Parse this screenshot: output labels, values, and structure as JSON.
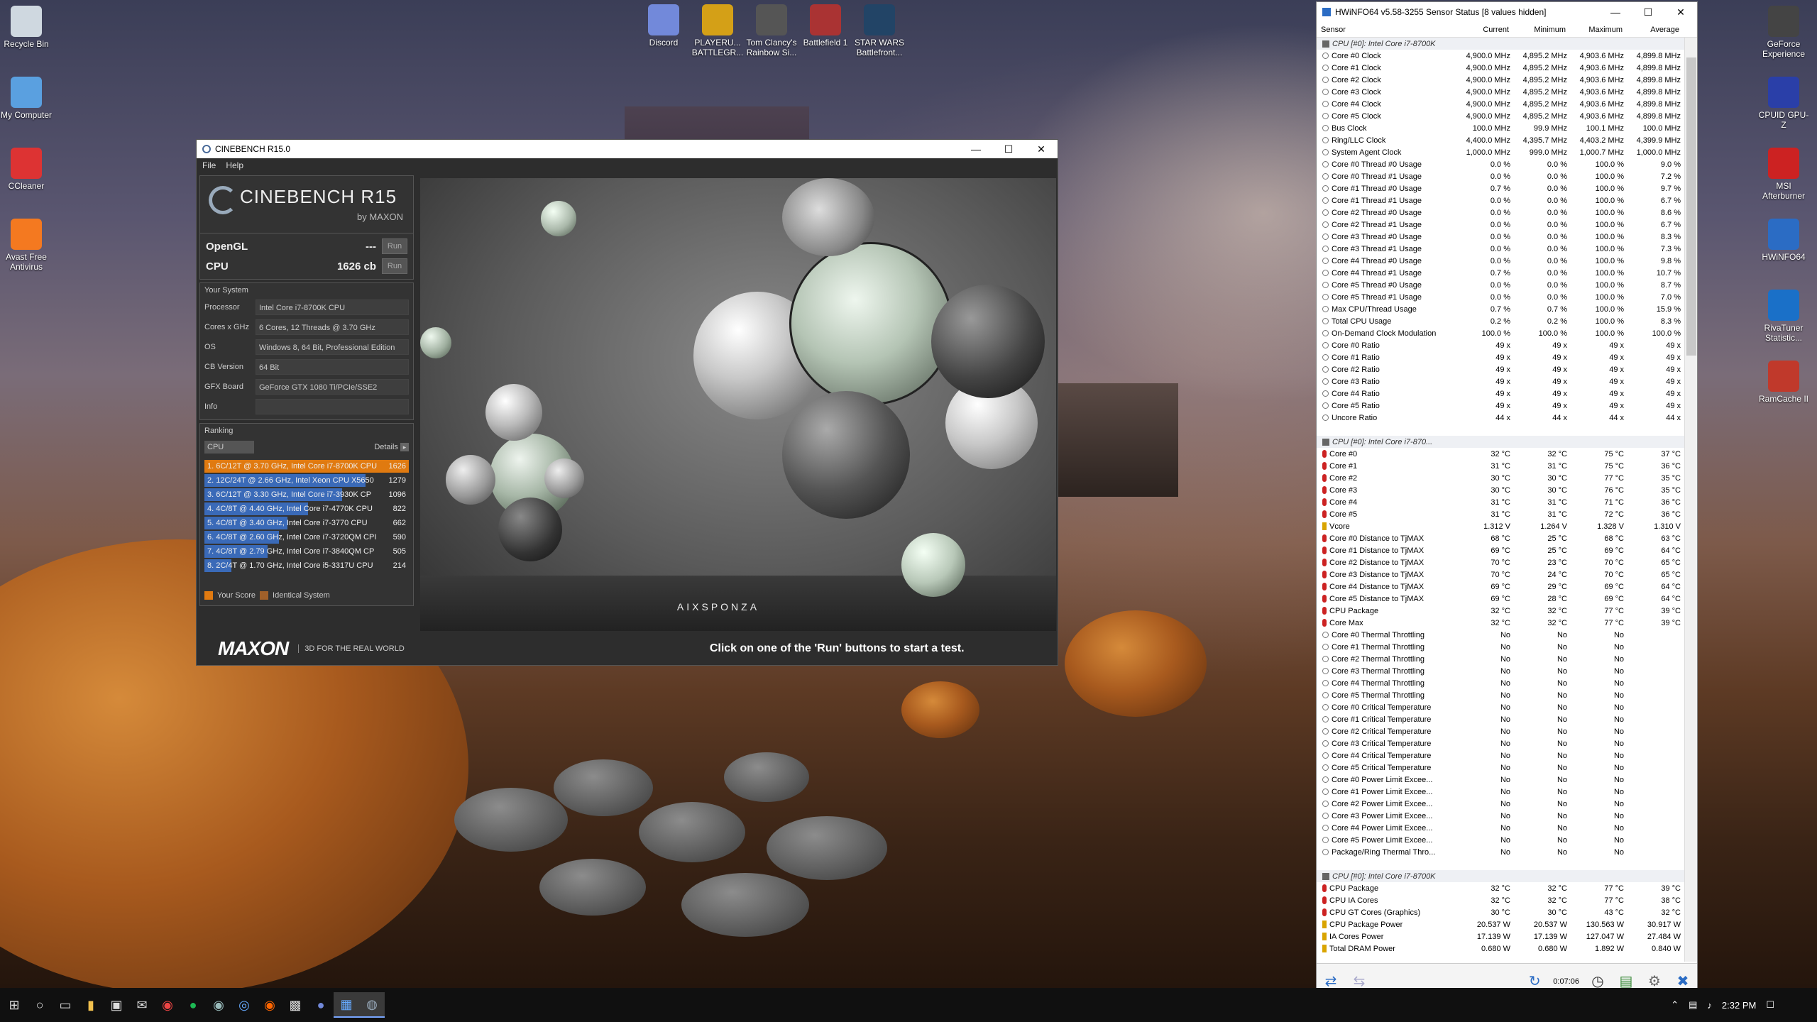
{
  "desktop": {
    "icons_left": [
      {
        "label": "Recycle Bin",
        "icon": "recycle-bin-icon"
      },
      {
        "label": "My Computer",
        "icon": "computer-icon"
      },
      {
        "label": "CCleaner",
        "icon": "ccleaner-icon"
      },
      {
        "label": "Avast Free Antivirus",
        "icon": "avast-icon"
      }
    ],
    "icons_top": [
      {
        "label": "Discord",
        "icon": "discord-icon"
      },
      {
        "label": "PLAYERU... BATTLEGR...",
        "icon": "pubg-icon"
      },
      {
        "label": "Tom Clancy's Rainbow Si...",
        "icon": "rainbow-six-icon"
      },
      {
        "label": "Battlefield 1",
        "icon": "battlefield-icon"
      },
      {
        "label": "STAR WARS Battlefront...",
        "icon": "star-wars-icon"
      }
    ],
    "icons_right": [
      {
        "label": "GeForce Experience",
        "icon": "geforce-icon"
      },
      {
        "label": "CPUID GPU-Z",
        "icon": "gpuz-icon"
      },
      {
        "label": "MSI Afterburner",
        "icon": "afterburner-icon"
      },
      {
        "label": "HWiNFO64",
        "icon": "hwinfo-icon"
      },
      {
        "label": "RivaTuner Statistic...",
        "icon": "rivatuner-icon"
      },
      {
        "label": "RamCache II",
        "icon": "ramcache-icon"
      }
    ]
  },
  "cinebench": {
    "title": "CINEBENCH R15.0",
    "menu": [
      "File",
      "Help"
    ],
    "logo_title": "CINEBENCH R15",
    "logo_by": "by MAXON",
    "opengl_label": "OpenGL",
    "opengl_value": "---",
    "cpu_label": "CPU",
    "cpu_value": "1626 cb",
    "run_label": "Run",
    "your_system_title": "Your System",
    "system": [
      {
        "key": "Processor",
        "value": "Intel Core i7-8700K CPU"
      },
      {
        "key": "Cores x GHz",
        "value": "6 Cores, 12 Threads @ 3.70 GHz"
      },
      {
        "key": "OS",
        "value": "Windows 8, 64 Bit, Professional Edition"
      },
      {
        "key": "CB Version",
        "value": "64 Bit"
      },
      {
        "key": "GFX Board",
        "value": "GeForce GTX 1080 Ti/PCIe/SSE2"
      },
      {
        "key": "Info",
        "value": ""
      }
    ],
    "ranking_title": "Ranking",
    "ranking_dropdown": "CPU",
    "details_label": "Details",
    "ranking": [
      {
        "text": "1. 6C/12T @ 3.70 GHz, Intel Core i7-8700K CPU",
        "score": 1626,
        "mine": true
      },
      {
        "text": "2. 12C/24T @ 2.66 GHz, Intel Xeon CPU X5650",
        "score": 1279,
        "mine": false
      },
      {
        "text": "3. 6C/12T @ 3.30 GHz,  Intel Core i7-3930K CP",
        "score": 1096,
        "mine": false
      },
      {
        "text": "4. 4C/8T @ 4.40 GHz, Intel Core i7-4770K CPU",
        "score": 822,
        "mine": false
      },
      {
        "text": "5. 4C/8T @ 3.40 GHz,  Intel Core i7-3770 CPU",
        "score": 662,
        "mine": false
      },
      {
        "text": "6. 4C/8T @ 2.60 GHz, Intel Core i7-3720QM CPI",
        "score": 590,
        "mine": false
      },
      {
        "text": "7. 4C/8T @ 2.79 GHz,  Intel Core i7-3840QM CP",
        "score": 505,
        "mine": false
      },
      {
        "text": "8. 2C/4T @ 1.70 GHz,  Intel Core i5-3317U CPU",
        "score": 214,
        "mine": false
      }
    ],
    "legend_your_score": "Your Score",
    "legend_identical": "Identical System",
    "brand": "MAXON",
    "tagline": "3D FOR THE REAL WORLD",
    "status_message": "Click on one of the 'Run' buttons to start a test.",
    "render_logo": "AIXSPONZA",
    "colors": {
      "mine": "#e07a10",
      "others": "#3a6ab8",
      "identical": "#a0602a"
    }
  },
  "hwinfo": {
    "title": "HWiNFO64 v5.58-3255 Sensor Status [8 values hidden]",
    "columns": [
      "Sensor",
      "Current",
      "Minimum",
      "Maximum",
      "Average"
    ],
    "timer": "0:07:06",
    "groups": [
      {
        "name": "CPU [#0]: Intel Core i7-8700K",
        "rows": [
          [
            "Core #0 Clock",
            "4,900.0 MHz",
            "4,895.2 MHz",
            "4,903.6 MHz",
            "4,899.8 MHz",
            "dot"
          ],
          [
            "Core #1 Clock",
            "4,900.0 MHz",
            "4,895.2 MHz",
            "4,903.6 MHz",
            "4,899.8 MHz",
            "dot"
          ],
          [
            "Core #2 Clock",
            "4,900.0 MHz",
            "4,895.2 MHz",
            "4,903.6 MHz",
            "4,899.8 MHz",
            "dot"
          ],
          [
            "Core #3 Clock",
            "4,900.0 MHz",
            "4,895.2 MHz",
            "4,903.6 MHz",
            "4,899.8 MHz",
            "dot"
          ],
          [
            "Core #4 Clock",
            "4,900.0 MHz",
            "4,895.2 MHz",
            "4,903.6 MHz",
            "4,899.8 MHz",
            "dot"
          ],
          [
            "Core #5 Clock",
            "4,900.0 MHz",
            "4,895.2 MHz",
            "4,903.6 MHz",
            "4,899.8 MHz",
            "dot"
          ],
          [
            "Bus Clock",
            "100.0 MHz",
            "99.9 MHz",
            "100.1 MHz",
            "100.0 MHz",
            "dot"
          ],
          [
            "Ring/LLC Clock",
            "4,400.0 MHz",
            "4,395.7 MHz",
            "4,403.2 MHz",
            "4,399.9 MHz",
            "dot"
          ],
          [
            "System Agent Clock",
            "1,000.0 MHz",
            "999.0 MHz",
            "1,000.7 MHz",
            "1,000.0 MHz",
            "dot"
          ],
          [
            "Core #0 Thread #0 Usage",
            "0.0 %",
            "0.0 %",
            "100.0 %",
            "9.0 %",
            "dot"
          ],
          [
            "Core #0 Thread #1 Usage",
            "0.0 %",
            "0.0 %",
            "100.0 %",
            "7.2 %",
            "dot"
          ],
          [
            "Core #1 Thread #0 Usage",
            "0.7 %",
            "0.0 %",
            "100.0 %",
            "9.7 %",
            "dot"
          ],
          [
            "Core #1 Thread #1 Usage",
            "0.0 %",
            "0.0 %",
            "100.0 %",
            "6.7 %",
            "dot"
          ],
          [
            "Core #2 Thread #0 Usage",
            "0.0 %",
            "0.0 %",
            "100.0 %",
            "8.6 %",
            "dot"
          ],
          [
            "Core #2 Thread #1 Usage",
            "0.0 %",
            "0.0 %",
            "100.0 %",
            "6.7 %",
            "dot"
          ],
          [
            "Core #3 Thread #0 Usage",
            "0.0 %",
            "0.0 %",
            "100.0 %",
            "8.3 %",
            "dot"
          ],
          [
            "Core #3 Thread #1 Usage",
            "0.0 %",
            "0.0 %",
            "100.0 %",
            "7.3 %",
            "dot"
          ],
          [
            "Core #4 Thread #0 Usage",
            "0.0 %",
            "0.0 %",
            "100.0 %",
            "9.8 %",
            "dot"
          ],
          [
            "Core #4 Thread #1 Usage",
            "0.7 %",
            "0.0 %",
            "100.0 %",
            "10.7 %",
            "dot"
          ],
          [
            "Core #5 Thread #0 Usage",
            "0.0 %",
            "0.0 %",
            "100.0 %",
            "8.7 %",
            "dot"
          ],
          [
            "Core #5 Thread #1 Usage",
            "0.0 %",
            "0.0 %",
            "100.0 %",
            "7.0 %",
            "dot"
          ],
          [
            "Max CPU/Thread Usage",
            "0.7 %",
            "0.7 %",
            "100.0 %",
            "15.9 %",
            "dot"
          ],
          [
            "Total CPU Usage",
            "0.2 %",
            "0.2 %",
            "100.0 %",
            "8.3 %",
            "dot"
          ],
          [
            "On-Demand Clock Modulation",
            "100.0 %",
            "100.0 %",
            "100.0 %",
            "100.0 %",
            "dot"
          ],
          [
            "Core #0 Ratio",
            "49 x",
            "49 x",
            "49 x",
            "49 x",
            "dot"
          ],
          [
            "Core #1 Ratio",
            "49 x",
            "49 x",
            "49 x",
            "49 x",
            "dot"
          ],
          [
            "Core #2 Ratio",
            "49 x",
            "49 x",
            "49 x",
            "49 x",
            "dot"
          ],
          [
            "Core #3 Ratio",
            "49 x",
            "49 x",
            "49 x",
            "49 x",
            "dot"
          ],
          [
            "Core #4 Ratio",
            "49 x",
            "49 x",
            "49 x",
            "49 x",
            "dot"
          ],
          [
            "Core #5 Ratio",
            "49 x",
            "49 x",
            "49 x",
            "49 x",
            "dot"
          ],
          [
            "Uncore Ratio",
            "44 x",
            "44 x",
            "44 x",
            "44 x",
            "dot"
          ]
        ]
      },
      {
        "name": "CPU [#0]: Intel Core i7-870...",
        "rows": [
          [
            "Core #0",
            "32 °C",
            "32 °C",
            "75 °C",
            "37 °C",
            "therm"
          ],
          [
            "Core #1",
            "31 °C",
            "31 °C",
            "75 °C",
            "36 °C",
            "therm"
          ],
          [
            "Core #2",
            "30 °C",
            "30 °C",
            "77 °C",
            "35 °C",
            "therm"
          ],
          [
            "Core #3",
            "30 °C",
            "30 °C",
            "76 °C",
            "35 °C",
            "therm"
          ],
          [
            "Core #4",
            "31 °C",
            "31 °C",
            "71 °C",
            "36 °C",
            "therm"
          ],
          [
            "Core #5",
            "31 °C",
            "31 °C",
            "72 °C",
            "36 °C",
            "therm"
          ],
          [
            "Vcore",
            "1.312 V",
            "1.264 V",
            "1.328 V",
            "1.310 V",
            "bolt"
          ],
          [
            "Core #0 Distance to TjMAX",
            "68 °C",
            "25 °C",
            "68 °C",
            "63 °C",
            "therm"
          ],
          [
            "Core #1 Distance to TjMAX",
            "69 °C",
            "25 °C",
            "69 °C",
            "64 °C",
            "therm"
          ],
          [
            "Core #2 Distance to TjMAX",
            "70 °C",
            "23 °C",
            "70 °C",
            "65 °C",
            "therm"
          ],
          [
            "Core #3 Distance to TjMAX",
            "70 °C",
            "24 °C",
            "70 °C",
            "65 °C",
            "therm"
          ],
          [
            "Core #4 Distance to TjMAX",
            "69 °C",
            "29 °C",
            "69 °C",
            "64 °C",
            "therm"
          ],
          [
            "Core #5 Distance to TjMAX",
            "69 °C",
            "28 °C",
            "69 °C",
            "64 °C",
            "therm"
          ],
          [
            "CPU Package",
            "32 °C",
            "32 °C",
            "77 °C",
            "39 °C",
            "therm"
          ],
          [
            "Core Max",
            "32 °C",
            "32 °C",
            "77 °C",
            "39 °C",
            "therm"
          ],
          [
            "Core #0 Thermal Throttling",
            "No",
            "No",
            "No",
            "",
            "dot"
          ],
          [
            "Core #1 Thermal Throttling",
            "No",
            "No",
            "No",
            "",
            "dot"
          ],
          [
            "Core #2 Thermal Throttling",
            "No",
            "No",
            "No",
            "",
            "dot"
          ],
          [
            "Core #3 Thermal Throttling",
            "No",
            "No",
            "No",
            "",
            "dot"
          ],
          [
            "Core #4 Thermal Throttling",
            "No",
            "No",
            "No",
            "",
            "dot"
          ],
          [
            "Core #5 Thermal Throttling",
            "No",
            "No",
            "No",
            "",
            "dot"
          ],
          [
            "Core #0 Critical Temperature",
            "No",
            "No",
            "No",
            "",
            "dot"
          ],
          [
            "Core #1 Critical Temperature",
            "No",
            "No",
            "No",
            "",
            "dot"
          ],
          [
            "Core #2 Critical Temperature",
            "No",
            "No",
            "No",
            "",
            "dot"
          ],
          [
            "Core #3 Critical Temperature",
            "No",
            "No",
            "No",
            "",
            "dot"
          ],
          [
            "Core #4 Critical Temperature",
            "No",
            "No",
            "No",
            "",
            "dot"
          ],
          [
            "Core #5 Critical Temperature",
            "No",
            "No",
            "No",
            "",
            "dot"
          ],
          [
            "Core #0 Power Limit Excee...",
            "No",
            "No",
            "No",
            "",
            "dot"
          ],
          [
            "Core #1 Power Limit Excee...",
            "No",
            "No",
            "No",
            "",
            "dot"
          ],
          [
            "Core #2 Power Limit Excee...",
            "No",
            "No",
            "No",
            "",
            "dot"
          ],
          [
            "Core #3 Power Limit Excee...",
            "No",
            "No",
            "No",
            "",
            "dot"
          ],
          [
            "Core #4 Power Limit Excee...",
            "No",
            "No",
            "No",
            "",
            "dot"
          ],
          [
            "Core #5 Power Limit Excee...",
            "No",
            "No",
            "No",
            "",
            "dot"
          ],
          [
            "Package/Ring Thermal Thro...",
            "No",
            "No",
            "No",
            "",
            "dot"
          ]
        ]
      },
      {
        "name": "CPU [#0]: Intel Core i7-8700K",
        "rows": [
          [
            "CPU Package",
            "32 °C",
            "32 °C",
            "77 °C",
            "39 °C",
            "therm"
          ],
          [
            "CPU IA Cores",
            "32 °C",
            "32 °C",
            "77 °C",
            "38 °C",
            "therm"
          ],
          [
            "CPU GT Cores (Graphics)",
            "30 °C",
            "30 °C",
            "43 °C",
            "32 °C",
            "therm"
          ],
          [
            "CPU Package Power",
            "20.537 W",
            "20.537 W",
            "130.563 W",
            "30.917 W",
            "bolt"
          ],
          [
            "IA Cores Power",
            "17.139 W",
            "17.139 W",
            "127.047 W",
            "27.484 W",
            "bolt"
          ],
          [
            "Total DRAM Power",
            "0.680 W",
            "0.680 W",
            "1.892 W",
            "0.840 W",
            "bolt"
          ]
        ]
      }
    ]
  },
  "taskbar": {
    "time": "2:32 PM"
  }
}
